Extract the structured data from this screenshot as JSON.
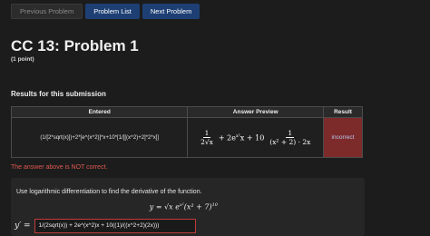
{
  "nav": {
    "previous": "Previous Problem",
    "list": "Problem List",
    "next": "Next Problem"
  },
  "title": "CC 13: Problem 1",
  "points": "(1 point)",
  "results_heading": "Results for this submission",
  "table": {
    "headers": [
      "Entered",
      "Answer Preview",
      "Result"
    ],
    "entered": "(1/[2*sqrt(x)])+2*[e^(x^2)]*x+10*[1/[[(x^2)+2]*2*x]]",
    "preview": {
      "t1_num": "1",
      "t1_den": "2√x",
      "mid": "+ 2e",
      "mid_exp": "x²",
      "mid_tail": "x + 10",
      "t3_num": "1",
      "t3_den": "(x² + 2) · 2x"
    },
    "result": "incorrect"
  },
  "feedback": "The answer above is NOT correct.",
  "problem": {
    "prompt": "Use logarithmic differentiation to find the derivative of the function.",
    "equation_lhs": "y = √x e",
    "equation_exp1": "x²",
    "equation_mid": "(x² + 7)",
    "equation_exp2": "10",
    "answer_label": "y′ =",
    "answer_value": "1/(2sqrt(x)) + 2e^(x^2)x + 10((1)/((x^2+2)(2x)))"
  },
  "colors": {
    "background": "#1c1c1c",
    "nav_primary": "#1d3f74",
    "incorrect_cell": "#7d2a2a",
    "error_text": "#e0584f"
  }
}
